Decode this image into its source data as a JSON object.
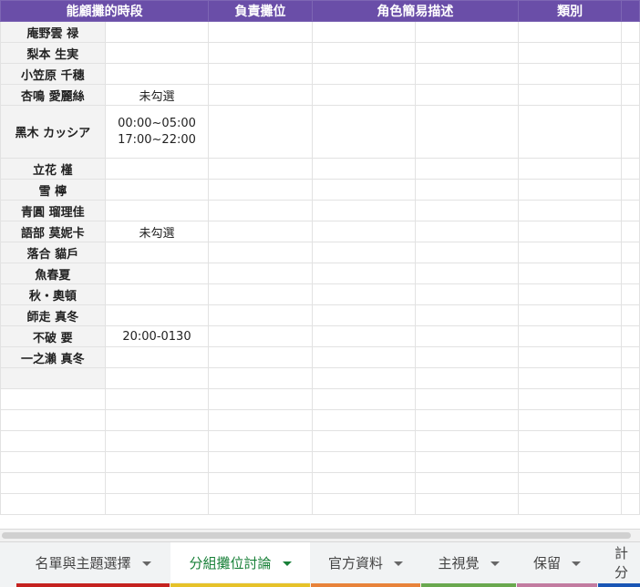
{
  "header": {
    "col1": "能顧攤的時段",
    "col2": "負責攤位",
    "col3": "角色簡易描述",
    "col4": "類別"
  },
  "rows": [
    {
      "name": "庵野雲 禄",
      "time": ""
    },
    {
      "name": "梨本 生実",
      "time": ""
    },
    {
      "name": "小笠原 千穗",
      "time": ""
    },
    {
      "name": "杏鳴 愛麗絲",
      "time": "未勾選"
    },
    {
      "name": "黑木 カッシア",
      "time": "00:00~05:00\n17:00~22:00"
    },
    {
      "name": "立花 槿",
      "time": ""
    },
    {
      "name": "雪 檸",
      "time": ""
    },
    {
      "name": "青圓 瑠理佳",
      "time": ""
    },
    {
      "name": "語部 莫妮卡",
      "time": "未勾選"
    },
    {
      "name": "落合 貓戶",
      "time": ""
    },
    {
      "name": "魚春夏",
      "time": ""
    },
    {
      "name": "秋・奧頓",
      "time": ""
    },
    {
      "name": "師走 真冬",
      "time": ""
    },
    {
      "name": "不破 要",
      "time": "20:00-0130"
    },
    {
      "name": "一之瀨 真冬",
      "time": ""
    }
  ],
  "tabs": [
    {
      "label": "名單與主題選擇",
      "color": "#c5221f",
      "active": false
    },
    {
      "label": "分組攤位討論",
      "color": "#e6c229",
      "active": true
    },
    {
      "label": "官方資料",
      "color": "#e8833a",
      "active": false
    },
    {
      "label": "主視覺",
      "color": "#6aa84f",
      "active": false
    },
    {
      "label": "保留",
      "color": "#c27ba0",
      "active": false
    },
    {
      "label": "計分",
      "color": "#1a56b5",
      "active": false
    }
  ],
  "colors": {
    "header_bg": "#6a4ea8",
    "name_bg": "#f3f3f3",
    "active_tab_text": "#188038"
  }
}
